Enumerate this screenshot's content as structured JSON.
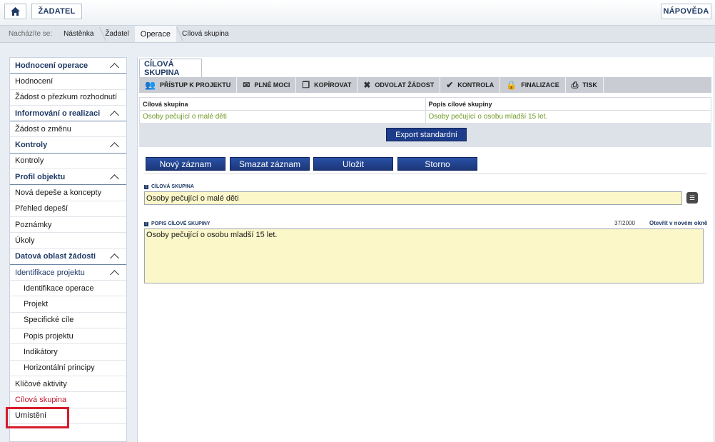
{
  "topbar": {
    "home_icon": "home-icon",
    "zadatel": "ŽADATEL",
    "help": "NÁPOVĚDA"
  },
  "breadcrumb": {
    "label": "Nacházíte se:",
    "items": [
      "Nástěnka",
      "Žadatel",
      "Operace",
      "Cílová skupina"
    ]
  },
  "sidebar": {
    "items": [
      {
        "label": "Hodnocení operace",
        "type": "head"
      },
      {
        "label": "Hodnocení",
        "type": "item"
      },
      {
        "label": "Žádost o přezkum rozhodnutí",
        "type": "item"
      },
      {
        "label": "Informování o realizaci",
        "type": "head"
      },
      {
        "label": "Žádost o změnu",
        "type": "item"
      },
      {
        "label": "Kontroly",
        "type": "head"
      },
      {
        "label": "Kontroly",
        "type": "item"
      },
      {
        "label": "Profil objektu",
        "type": "head"
      },
      {
        "label": "Nová depeše a koncepty",
        "type": "item"
      },
      {
        "label": "Přehled depeší",
        "type": "item"
      },
      {
        "label": "Poznámky",
        "type": "item"
      },
      {
        "label": "Úkoly",
        "type": "item"
      },
      {
        "label": "Datová oblast žádosti",
        "type": "head"
      },
      {
        "label": "Identifikace projektu",
        "type": "group"
      },
      {
        "label": "Identifikace operace",
        "type": "sub"
      },
      {
        "label": "Projekt",
        "type": "sub"
      },
      {
        "label": "Specifické cíle",
        "type": "sub"
      },
      {
        "label": "Popis projektu",
        "type": "sub"
      },
      {
        "label": "Indikátory",
        "type": "sub"
      },
      {
        "label": "Horizontální principy",
        "type": "sub"
      },
      {
        "label": "Klíčové aktivity",
        "type": "item"
      },
      {
        "label": "Cílová skupina",
        "type": "active"
      },
      {
        "label": "Umístění",
        "type": "item"
      }
    ]
  },
  "main": {
    "tab": "CÍLOVÁ SKUPINA",
    "toolbar": [
      {
        "label": "PŘÍSTUP K PROJEKTU",
        "icon": "users-icon"
      },
      {
        "label": "PLNÉ MOCI",
        "icon": "envelope-icon"
      },
      {
        "label": "KOPÍROVAT",
        "icon": "copy-icon"
      },
      {
        "label": "ODVOLAT ŽÁDOST",
        "icon": "close-icon"
      },
      {
        "label": "KONTROLA",
        "icon": "check-icon"
      },
      {
        "label": "FINALIZACE",
        "icon": "lock-icon"
      },
      {
        "label": "TISK",
        "icon": "print-icon"
      }
    ],
    "grid": {
      "headers": [
        "Cílová skupina",
        "Popis cílové skupiny"
      ],
      "rows": [
        [
          "Osoby pečující o malé děti",
          "Osoby pečující o osobu mladší 15 let."
        ]
      ]
    },
    "export_button": "Export standardní",
    "actions": [
      "Nový záznam",
      "Smazat záznam",
      "Uložit",
      "Storno"
    ],
    "fields": {
      "target_group_label": "CÍLOVÁ SKUPINA",
      "target_group_value": "Osoby pečující o malé děti",
      "description_label": "POPIS CÍLOVÉ SKUPINY",
      "description_counter": "37/2000",
      "open_new_window": "Otevřít v novém okně",
      "description_value": "Osoby pečující o osobu mladší 15 let."
    }
  }
}
